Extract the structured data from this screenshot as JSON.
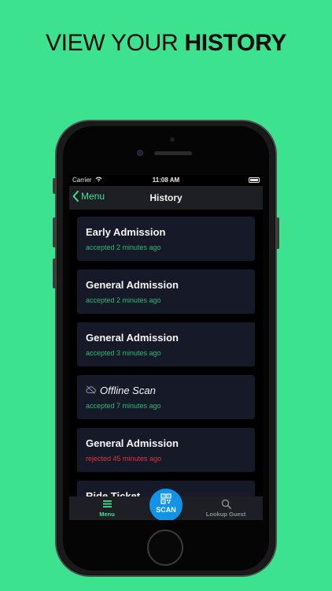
{
  "headline": {
    "light": "VIEW YOUR ",
    "bold": "HISTORY"
  },
  "statusbar": {
    "carrier": "Carrier",
    "time": "11:08 AM"
  },
  "navbar": {
    "back_label": "Menu",
    "title": "History"
  },
  "history": [
    {
      "name": "Early Admission",
      "status": "accepted 2 minutes ago",
      "state": "accepted"
    },
    {
      "name": "General Admission",
      "status": "accepted 2 minutes ago",
      "state": "accepted"
    },
    {
      "name": "General Admission",
      "status": "accepted 3 minutes ago",
      "state": "accepted"
    },
    {
      "name": "Offline Scan",
      "status": "accepted 7 minutes ago",
      "state": "accepted",
      "icon": "cloud-offline-icon"
    },
    {
      "name": "General Admission",
      "status": "rejected 45 minutes ago",
      "state": "rejected"
    },
    {
      "name": "Ride Ticket",
      "status": "",
      "state": "accepted"
    }
  ],
  "tabbar": {
    "menu_label": "Menu",
    "scan_label": "SCAN",
    "lookup_label": "Lookup Guest"
  },
  "colors": {
    "accent": "#3de28f",
    "accepted": "#2eb873",
    "rejected": "#e0333c",
    "scan": "#1193e8",
    "card": "#161a28"
  }
}
